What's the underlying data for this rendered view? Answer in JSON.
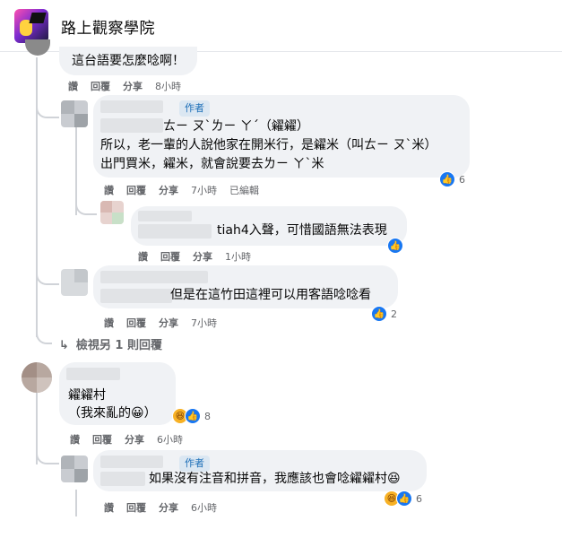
{
  "header": {
    "page_name": "路上觀察學院"
  },
  "actions_labels": {
    "like": "讚",
    "reply": "回覆",
    "share": "分享",
    "edited": "已編輯"
  },
  "author_badge": "作者",
  "comments": [
    {
      "id": "c0",
      "lines": [
        "這台語要怎麼唸啊！"
      ],
      "time": "8小時"
    },
    {
      "id": "c1",
      "author_badge": true,
      "lines": [
        "ㄊㄧ ㄡˋㄌㄧ ㄚˊ（糴糴）",
        "所以，老一輩的人說他家在開米行，是糴米（叫ㄊㄧ ㄡˋ米）",
        "出門買米，糴米，就會說要去ㄌㄧ ㄚˋ米"
      ],
      "time": "7小時",
      "edited": true,
      "reactions": {
        "like": true,
        "count": "6"
      }
    },
    {
      "id": "c2",
      "lines": [
        "tiah4入聲，可惜國語無法表現"
      ],
      "time": "1小時",
      "reactions": {
        "like": true,
        "count": ""
      }
    },
    {
      "id": "c3",
      "lines": [
        "但是在這竹田這裡可以用客語唸唸看"
      ],
      "time": "7小時",
      "reactions": {
        "like": true,
        "count": "2"
      }
    },
    {
      "id": "c4",
      "lines": [
        "糴糴村",
        "（我來亂的😀）"
      ],
      "time": "6小時",
      "reactions": {
        "like": true,
        "haha": true,
        "count": "8"
      }
    },
    {
      "id": "c5",
      "author_badge": true,
      "lines": [
        "如果沒有注音和拼音，我應該也會唸糴糴村😆"
      ],
      "time": "6小時",
      "reactions": {
        "like": true,
        "haha": true,
        "count": "6"
      }
    }
  ],
  "view_more": "檢視另 1 則回覆",
  "icons": {
    "like": "thumbs-up",
    "haha": "laughing-face",
    "reply_arrow": "return-arrow"
  },
  "colors": {
    "like_blue": "#1877f2",
    "bubble_gray": "#f0f2f5",
    "meta_gray": "#65676b",
    "author_blue": "#1d6fb8"
  }
}
